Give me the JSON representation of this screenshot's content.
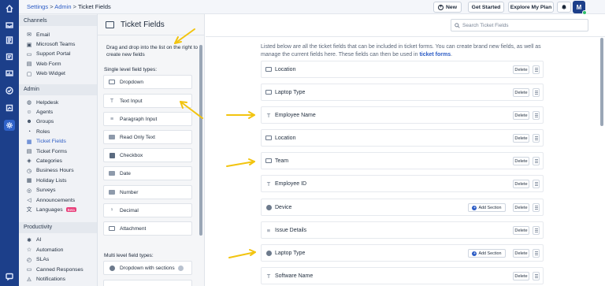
{
  "rail": {
    "icons": [
      "home-icon",
      "inbox-icon",
      "contacts-icon",
      "knowledge-icon",
      "reports-icon",
      "tasks-icon",
      "analytics-icon",
      "settings-icon",
      "chat-icon"
    ],
    "active_index": 7
  },
  "header": {
    "breadcrumb": {
      "part1": "Settings",
      "sep1": " > ",
      "part2": "Admin",
      "sep2": " > ",
      "current": "Ticket Fields"
    },
    "new_label": "New",
    "get_started_label": "Get Started",
    "explore_label": "Explore My Plan",
    "avatar_initial": "M"
  },
  "sidebar": {
    "sections": [
      {
        "title": "Channels",
        "items": [
          {
            "label": "Email",
            "icon": "email-icon"
          },
          {
            "label": "Microsoft Teams",
            "icon": "teams-icon"
          },
          {
            "label": "Support Portal",
            "icon": "portal-icon"
          },
          {
            "label": "Web Form",
            "icon": "form-icon"
          },
          {
            "label": "Web Widget",
            "icon": "widget-icon"
          }
        ]
      },
      {
        "title": "Admin",
        "items": [
          {
            "label": "Helpdesk",
            "icon": "globe-icon"
          },
          {
            "label": "Agents",
            "icon": "agent-icon"
          },
          {
            "label": "Groups",
            "icon": "groups-icon"
          },
          {
            "label": "Roles",
            "icon": "roles-icon"
          },
          {
            "label": "Ticket Fields",
            "icon": "ticket-fields-icon",
            "active": true
          },
          {
            "label": "Ticket Forms",
            "icon": "ticket-forms-icon"
          },
          {
            "label": "Categories",
            "icon": "categories-icon"
          },
          {
            "label": "Business Hours",
            "icon": "clock-icon"
          },
          {
            "label": "Holiday Lists",
            "icon": "calendar-icon"
          },
          {
            "label": "Surveys",
            "icon": "survey-icon"
          },
          {
            "label": "Announcements",
            "icon": "megaphone-icon"
          },
          {
            "label": "Languages",
            "icon": "translate-icon",
            "badge": "Beta"
          }
        ]
      },
      {
        "title": "Productivity",
        "items": [
          {
            "label": "AI",
            "icon": "ai-icon"
          },
          {
            "label": "Automation",
            "icon": "automation-icon"
          },
          {
            "label": "SLAs",
            "icon": "sla-icon"
          },
          {
            "label": "Canned Responses",
            "icon": "canned-icon"
          },
          {
            "label": "Notifications",
            "icon": "bell-icon"
          }
        ]
      }
    ]
  },
  "field_panel": {
    "title": "Ticket Fields",
    "hint": "Drag and drop into the list on the right to create new fields",
    "single_heading": "Single level field types:",
    "single_types": [
      {
        "label": "Dropdown",
        "icon": "dropdown-icon"
      },
      {
        "label": "Text Input",
        "icon": "text-icon"
      },
      {
        "label": "Paragraph Input",
        "icon": "paragraph-icon"
      },
      {
        "label": "Read Only Text",
        "icon": "readonly-icon"
      },
      {
        "label": "Checkbox",
        "icon": "checkbox-icon"
      },
      {
        "label": "Date",
        "icon": "date-icon"
      },
      {
        "label": "Number",
        "icon": "number-icon"
      },
      {
        "label": "Decimal",
        "icon": "decimal-icon"
      },
      {
        "label": "Attachment",
        "icon": "attachment-icon"
      }
    ],
    "multi_heading": "Multi level field types:",
    "multi_types": [
      {
        "label": "Dropdown with sections",
        "icon": "dropdown-sections-icon"
      }
    ]
  },
  "main": {
    "search_placeholder": "Search Ticket Fields",
    "description": "Listed below are all the ticket fields that can be included in ticket forms. You can create brand new fields, as well as manage the current fields here. These fields can then be used in ",
    "description_link": "ticket forms",
    "description_end": ".",
    "delete_label": "Delete",
    "add_section_label": "Add Section",
    "fields": [
      {
        "label": "Location",
        "icon": "dropdown-icon"
      },
      {
        "label": "Laptop Type",
        "icon": "dropdown-icon"
      },
      {
        "label": "Employee Name",
        "icon": "text-icon"
      },
      {
        "label": "Location",
        "icon": "dropdown-icon"
      },
      {
        "label": "Team",
        "icon": "dropdown-icon"
      },
      {
        "label": "Employee ID",
        "icon": "text-icon"
      },
      {
        "label": "Device",
        "icon": "dropdown-sections-icon",
        "add_section": true
      },
      {
        "label": "Issue Details",
        "icon": "paragraph-icon"
      },
      {
        "label": "Laptop Type",
        "icon": "dropdown-sections-icon",
        "add_section": true
      },
      {
        "label": "Software Name",
        "icon": "text-icon"
      }
    ]
  },
  "colors": {
    "rail": "#1c3f8a",
    "accent": "#2c5cc5",
    "annotation_arrow": "#f2c40f"
  }
}
